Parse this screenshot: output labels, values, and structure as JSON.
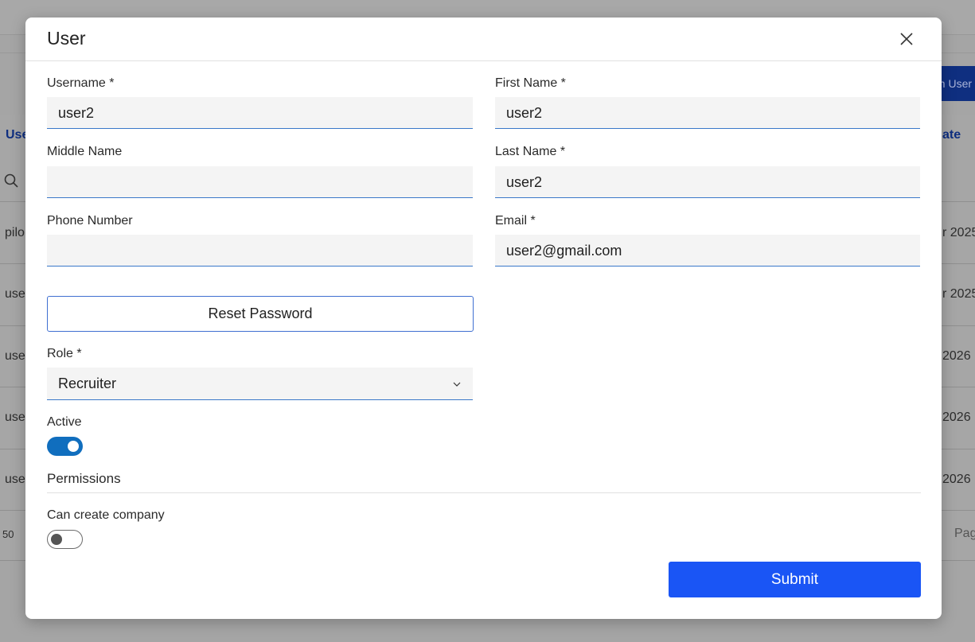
{
  "background": {
    "assign_button": "gn User",
    "column_left": "Use",
    "column_right": "ate",
    "rows": [
      {
        "left": "pilo",
        "right": "r 2025"
      },
      {
        "left": "use",
        "right": "r 2025"
      },
      {
        "left": "use",
        "right": "2026"
      },
      {
        "left": "use",
        "right": "2026"
      },
      {
        "left": "use",
        "right": "2026"
      }
    ],
    "page_size": "50",
    "pager": "Pag"
  },
  "modal": {
    "title": "User",
    "fields": {
      "username": {
        "label": "Username *",
        "value": "user2"
      },
      "first_name": {
        "label": "First Name *",
        "value": "user2"
      },
      "middle_name": {
        "label": "Middle Name",
        "value": ""
      },
      "last_name": {
        "label": "Last Name *",
        "value": "user2"
      },
      "phone": {
        "label": "Phone Number",
        "value": ""
      },
      "email": {
        "label": "Email *",
        "value": "user2@gmail.com"
      }
    },
    "reset_password_label": "Reset Password",
    "role": {
      "label": "Role *",
      "value": "Recruiter"
    },
    "active": {
      "label": "Active",
      "checked": true
    },
    "permissions": {
      "heading": "Permissions",
      "can_create_company": {
        "label": "Can create company",
        "checked": false
      }
    },
    "submit_label": "Submit"
  },
  "colors": {
    "primary": "#1a55f5",
    "toggle_on": "#106ebe",
    "input_underline": "#3a78c9"
  }
}
